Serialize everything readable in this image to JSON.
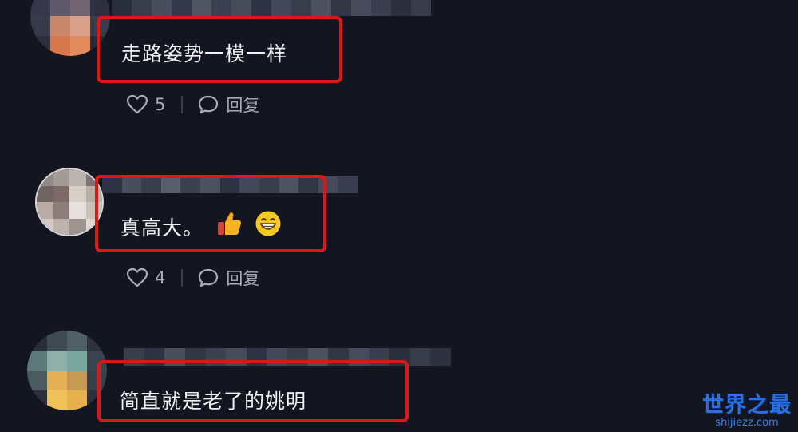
{
  "comments": [
    {
      "text": "走路姿势一模一样",
      "likes": "5",
      "reply_label": "回复"
    },
    {
      "text": "真高大。",
      "likes": "4",
      "reply_label": "回复"
    },
    {
      "text": "简直就是老了的姚明"
    }
  ],
  "watermark": {
    "title": "世界之最",
    "url": "shijiezz.com"
  },
  "colors": {
    "highlight": "#e01616",
    "background": "#131621",
    "watermark": "#2b6fe0"
  }
}
